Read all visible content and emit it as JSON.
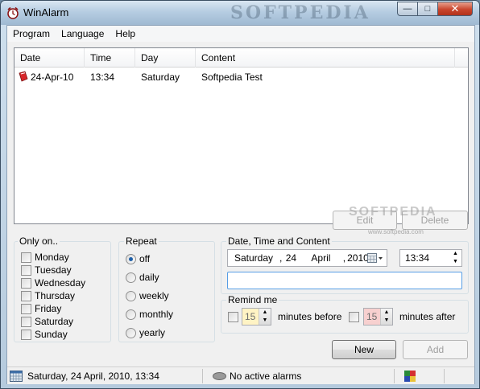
{
  "window": {
    "title": "WinAlarm",
    "watermark": "SOFTPEDIA"
  },
  "menu": [
    "Program",
    "Language",
    "Help"
  ],
  "alarm_list": {
    "columns": [
      "Date",
      "Time",
      "Day",
      "Content"
    ],
    "rows": [
      {
        "date": "24-Apr-10",
        "time": "13:34",
        "day": "Saturday",
        "content": "Softpedia Test"
      }
    ],
    "edit_label": "Edit",
    "delete_label": "Delete",
    "watermark": "SOFTPEDIA",
    "watermark_url": "www.softpedia.com"
  },
  "only_on": {
    "label": "Only on..",
    "days": [
      "Monday",
      "Tuesday",
      "Wednesday",
      "Thursday",
      "Friday",
      "Saturday",
      "Sunday"
    ]
  },
  "repeat": {
    "label": "Repeat",
    "options": [
      "off",
      "daily",
      "weekly",
      "monthly",
      "yearly"
    ],
    "selected": "off"
  },
  "date_time": {
    "label": "Date, Time and Content",
    "weekday": "Saturday",
    "day": "24",
    "month": "April",
    "year": "2010",
    "time": "13:34",
    "content": ""
  },
  "remind": {
    "label": "Remind me",
    "before_value": "15",
    "before_label": "minutes before",
    "after_value": "15",
    "after_label": "minutes after"
  },
  "actions": {
    "new_label": "New",
    "add_label": "Add"
  },
  "status": {
    "datetime": "Saturday, 24 April, 2010, 13:34",
    "alarms": "No active alarms"
  },
  "colors": {
    "remind_before_bg": "#fff3c4",
    "remind_after_bg": "#f7d0cf",
    "accent": "#1e5fa8"
  }
}
